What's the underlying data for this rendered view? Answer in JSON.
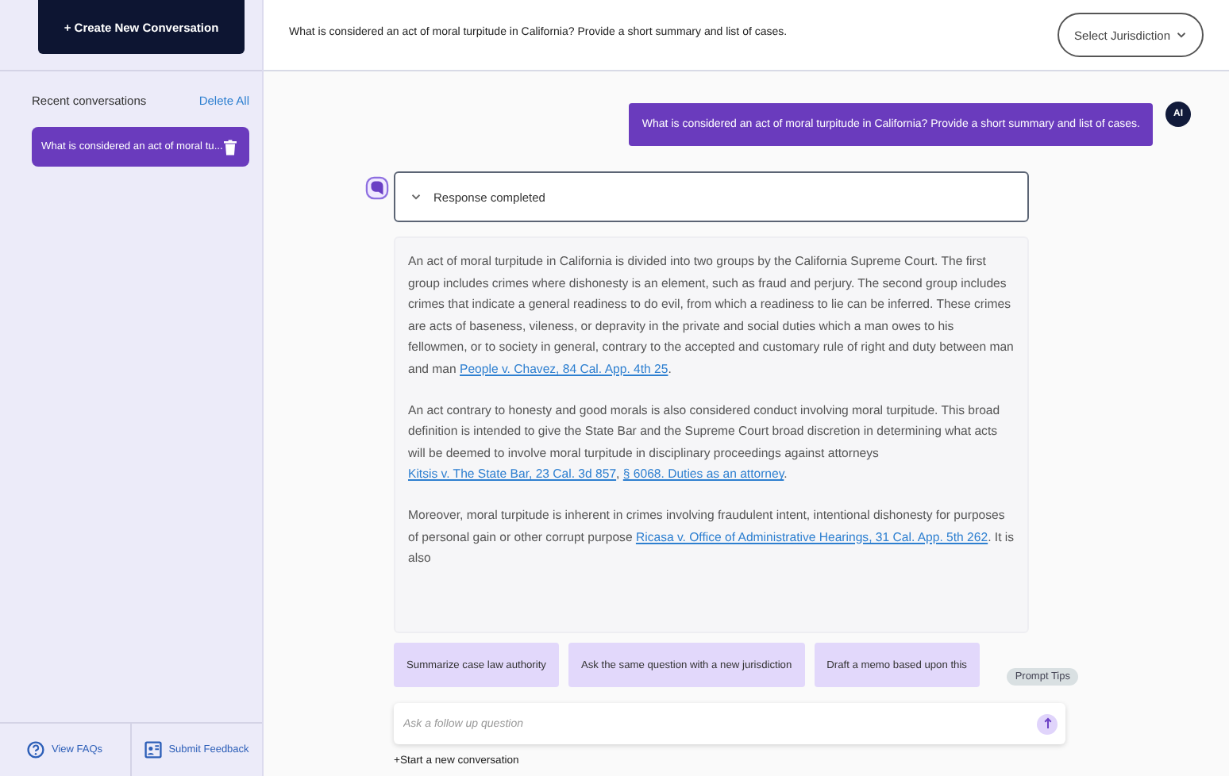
{
  "sidebar": {
    "new_button": "+ Create New Conversation",
    "recent_heading": "Recent conversations",
    "delete_all": "Delete All",
    "conversations": [
      {
        "title": "What is considered an act of moral tu...",
        "selected": true
      }
    ],
    "footer": [
      {
        "kind": "question",
        "label": "View FAQs"
      },
      {
        "kind": "feedback",
        "label": "Submit Feedback"
      }
    ]
  },
  "header": {
    "question": "What is considered an act of moral turpitude in California? Provide a short summary and list of cases.",
    "jurisdiction": "Select Jurisdiction"
  },
  "chat": {
    "user_message": "What is considered an act of moral turpitude in California? Provide a short summary and list of cases.",
    "user_avatar": "AI",
    "response_status": "Response completed",
    "paragraphs": [
      [
        {
          "text": "An act of moral turpitude in California is divided into two groups by the California Supreme Court. The first group includes crimes where dishonesty is an element, such as fraud and perjury. The second group includes crimes that indicate a general readiness to do evil, from which a readiness to lie can be inferred. These crimes are acts of baseness, vileness, or depravity in the private and social duties which a man owes to his fellowmen, or to society in general, contrary to the accepted and customary rule of right and duty between man and man "
        },
        {
          "text": "People v. Chavez, 84 Cal. App. 4th 25",
          "link": true
        },
        {
          "text": "."
        }
      ],
      [
        {
          "text": "An act contrary to honesty and good morals is also considered conduct involving moral turpitude. This broad definition is intended to give the State Bar and the Supreme Court broad discretion in determining what acts will be deemed to involve moral turpitude in disciplinary proceedings against attorneys "
        },
        {
          "text": "Kitsis v. The State Bar, 23 Cal. 3d 857",
          "link": true
        },
        {
          "text": ", "
        },
        {
          "text": "§ 6068. Duties as an attorney",
          "link": true
        },
        {
          "text": "."
        }
      ],
      [
        {
          "text": "Moreover, moral turpitude is inherent in crimes involving fraudulent intent, intentional dishonesty for purposes of personal gain or other corrupt purpose "
        },
        {
          "text": "Ricasa v. Office of Administrative Hearings, 31 Cal. App. 5th 262",
          "link": true
        },
        {
          "text": ". It is also"
        }
      ]
    ]
  },
  "suggestions": [
    "Summarize case law authority",
    "Ask the same question with a new jurisdiction",
    "Draft a memo based upon this"
  ],
  "prompt_tips": "Prompt Tips",
  "input": {
    "placeholder": "Ask a follow up question"
  },
  "start_new": "+Start a new conversation"
}
